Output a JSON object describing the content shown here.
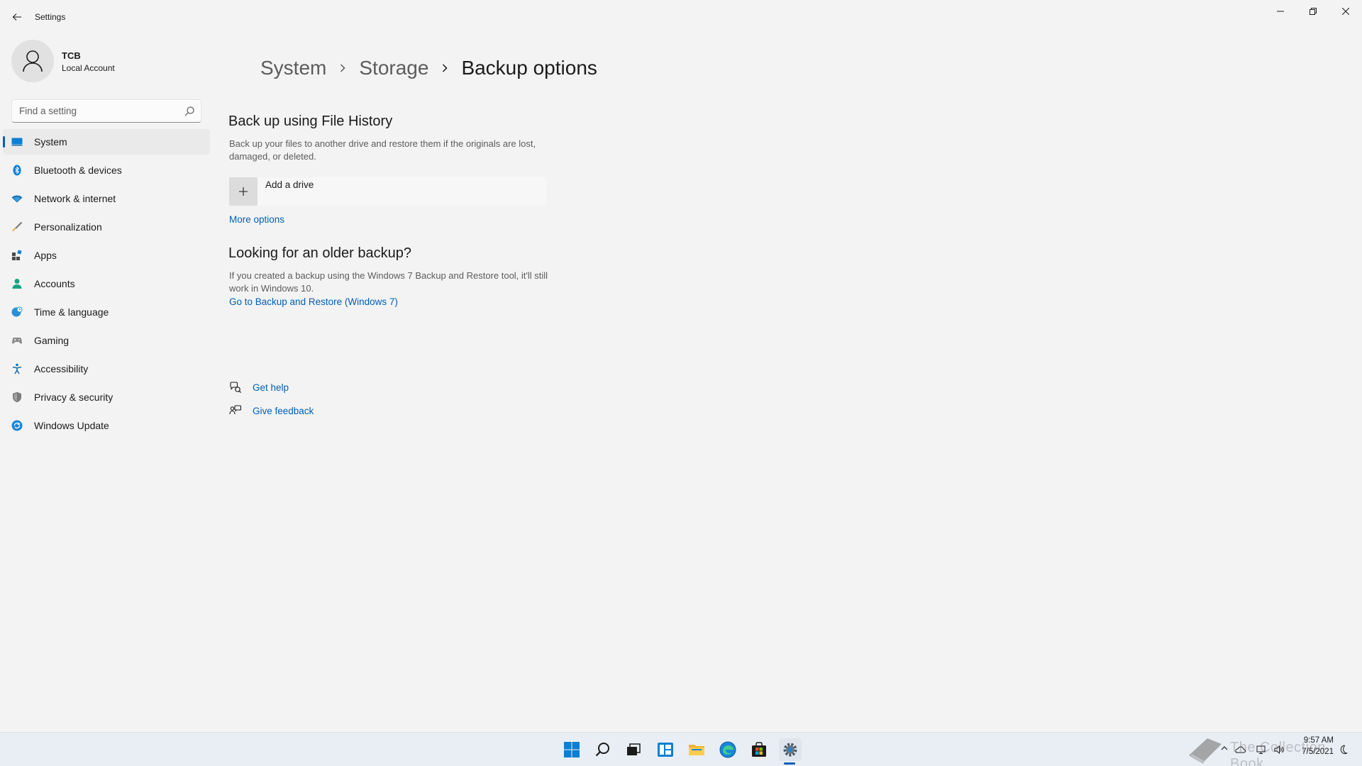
{
  "window": {
    "title": "Settings",
    "controls": [
      "minimize",
      "restore",
      "close"
    ]
  },
  "profile": {
    "name": "TCB",
    "account_type": "Local Account"
  },
  "search": {
    "placeholder": "Find a setting"
  },
  "sidebar": {
    "items": [
      {
        "label": "System",
        "icon": "system-icon",
        "selected": true
      },
      {
        "label": "Bluetooth & devices",
        "icon": "bluetooth-icon",
        "selected": false
      },
      {
        "label": "Network & internet",
        "icon": "wifi-icon",
        "selected": false
      },
      {
        "label": "Personalization",
        "icon": "brush-icon",
        "selected": false
      },
      {
        "label": "Apps",
        "icon": "apps-icon",
        "selected": false
      },
      {
        "label": "Accounts",
        "icon": "person-icon",
        "selected": false
      },
      {
        "label": "Time & language",
        "icon": "globe-clock-icon",
        "selected": false
      },
      {
        "label": "Gaming",
        "icon": "gamepad-icon",
        "selected": false
      },
      {
        "label": "Accessibility",
        "icon": "accessibility-icon",
        "selected": false
      },
      {
        "label": "Privacy & security",
        "icon": "shield-icon",
        "selected": false
      },
      {
        "label": "Windows Update",
        "icon": "update-icon",
        "selected": false
      }
    ]
  },
  "breadcrumb": {
    "items": [
      "System",
      "Storage"
    ],
    "current": "Backup options"
  },
  "file_history": {
    "title": "Back up using File History",
    "description": "Back up your files to another drive and restore them if the originals are lost, damaged, or deleted.",
    "add_drive_label": "Add a drive",
    "more_options_link": "More options"
  },
  "older_backup": {
    "title": "Looking for an older backup?",
    "description": "If you created a backup using the Windows 7 Backup and Restore tool, it'll still work in Windows 10.",
    "link": "Go to Backup and Restore (Windows 7)"
  },
  "help": {
    "get_help": "Get help",
    "give_feedback": "Give feedback"
  },
  "taskbar": {
    "apps": [
      "start-icon",
      "search-icon",
      "task-view-icon",
      "widgets-icon",
      "file-explorer-icon",
      "edge-icon",
      "store-icon",
      "settings-icon"
    ],
    "active_app": "settings-icon",
    "clock_time": "9:57 AM",
    "clock_date": "7/5/2021",
    "watermark": "The Collection Book"
  },
  "colors": {
    "accent": "#005fb8",
    "background": "#f3f3f3",
    "taskbar": "#e9eef4"
  }
}
